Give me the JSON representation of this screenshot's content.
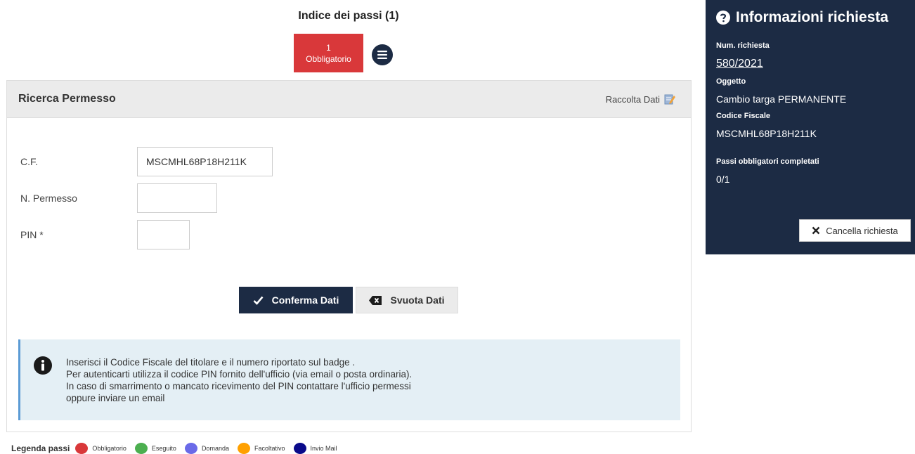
{
  "steps": {
    "title": "Indice dei passi (1)",
    "items": [
      {
        "number": "1",
        "label": "Obbligatorio",
        "color": "#d9383a"
      }
    ],
    "menu_icon": "hamburger-icon"
  },
  "panel": {
    "title": "Ricerca Permesso",
    "tag_label": "Raccolta Dati",
    "tag_icon": "edit-note-icon"
  },
  "form": {
    "cf": {
      "label": "C.F.",
      "value": "MSCMHL68P18H211K"
    },
    "permesso": {
      "label": "N. Permesso",
      "value": ""
    },
    "pin": {
      "label": "PIN *",
      "value": ""
    }
  },
  "buttons": {
    "confirm": {
      "label": "Conferma Dati",
      "icon": "check-icon"
    },
    "clear": {
      "label": "Svuota Dati",
      "icon": "backspace-icon"
    }
  },
  "info": {
    "icon": "info-icon",
    "lines": [
      "Inserisci il Codice Fiscale del titolare e il numero riportato sul badge .",
      "Per autenticarti utilizza il codice PIN fornito dell'ufficio (via email o posta ordinaria).",
      "In caso di smarrimento o mancato ricevimento del PIN contattare l'ufficio permessi",
      "oppure inviare un email"
    ]
  },
  "legend": {
    "title": "Legenda passi",
    "items": [
      {
        "label": "Obbligatorio",
        "color": "#d9383a"
      },
      {
        "label": "Eseguito",
        "color": "#4caf50"
      },
      {
        "label": "Domanda",
        "color": "#6a6ae8"
      },
      {
        "label": "Facoltativo",
        "color": "#ffa000"
      },
      {
        "label": "Invio Mail",
        "color": "#0a0a8a"
      }
    ]
  },
  "sidebar": {
    "title": "Informazioni richiesta",
    "title_icon": "question-circle-icon",
    "num_label": "Num. richiesta",
    "num_value": "580/2021",
    "oggetto_label": "Oggetto",
    "oggetto_value": "Cambio targa PERMANENTE",
    "cf_label": "Codice Fiscale",
    "cf_value": "MSCMHL68P18H211K",
    "passi_label": "Passi obbligatori completati",
    "passi_value": "0/1",
    "cancel_label": "Cancella richiesta",
    "cancel_icon": "close-icon"
  },
  "colors": {
    "navy": "#1c2b44",
    "step_red": "#d9383a",
    "info_bg": "#e4eff5",
    "info_border": "#5b9bd5"
  }
}
